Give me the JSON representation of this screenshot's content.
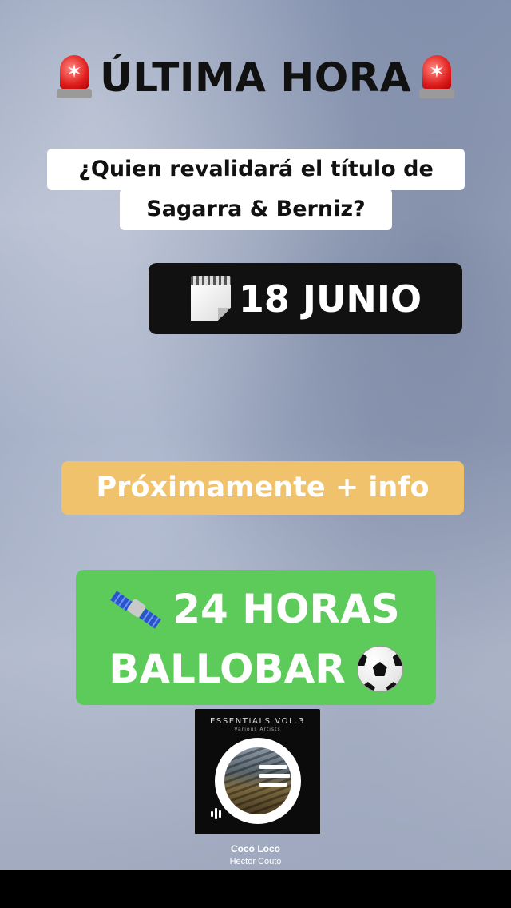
{
  "story": {
    "headline": "ÚLTIMA HORA",
    "headline_icons": [
      "police-light-icon",
      "police-light-icon"
    ],
    "question_line1": "¿Quien revalidará el título de",
    "question_line2": "Sagarra & Berniz?",
    "date_icon": "calendar-icon",
    "date": "18 JUNIO",
    "info": "Próximamente + info",
    "event_icon_left": "satellite-icon",
    "event_line1": "24 HORAS",
    "event_line2": "BALLOBAR",
    "event_icon_right": "soccer-ball-icon"
  },
  "music": {
    "album_title": "ESSENTIALS VOL.3",
    "album_subtitle": "Various Artists",
    "song_title": "Coco Loco",
    "artist": "Hector Couto"
  },
  "colors": {
    "date_box": "#111111",
    "info_box": "#f1c26c",
    "event_box": "#5dcb5a",
    "siren_red": "#e01f1f"
  }
}
